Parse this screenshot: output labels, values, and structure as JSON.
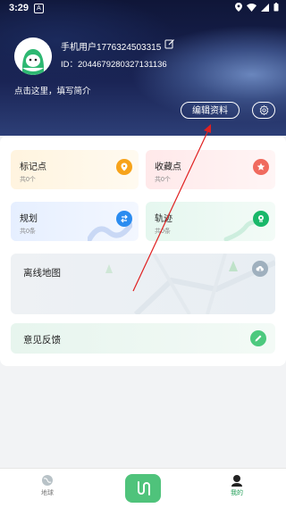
{
  "status_bar": {
    "time": "3:29"
  },
  "profile": {
    "username": "手机用户1776324503315",
    "user_id": "ID：2044679280327131136",
    "bio_prompt": "点击这里，填写简介",
    "edit_profile_label": "编辑资料"
  },
  "cards": {
    "markers": {
      "label": "标记点",
      "count": "共0个",
      "icon": "location-pin-icon"
    },
    "favorites": {
      "label": "收藏点",
      "count": "共0个",
      "icon": "star-icon"
    },
    "plans": {
      "label": "规划",
      "count": "共0条",
      "icon": "route-icon"
    },
    "tracks": {
      "label": "轨迹",
      "count": "共0条",
      "icon": "track-pin-icon"
    },
    "offline_map": {
      "label": "离线地图",
      "icon": "cloud-download-icon"
    },
    "feedback": {
      "label": "意见反馈",
      "icon": "pencil-icon"
    }
  },
  "tabbar": {
    "globe_label": "地球",
    "mine_label": "我的"
  },
  "colors": {
    "accent_green": "#4fc37b",
    "header_navy": "#1a2455"
  }
}
